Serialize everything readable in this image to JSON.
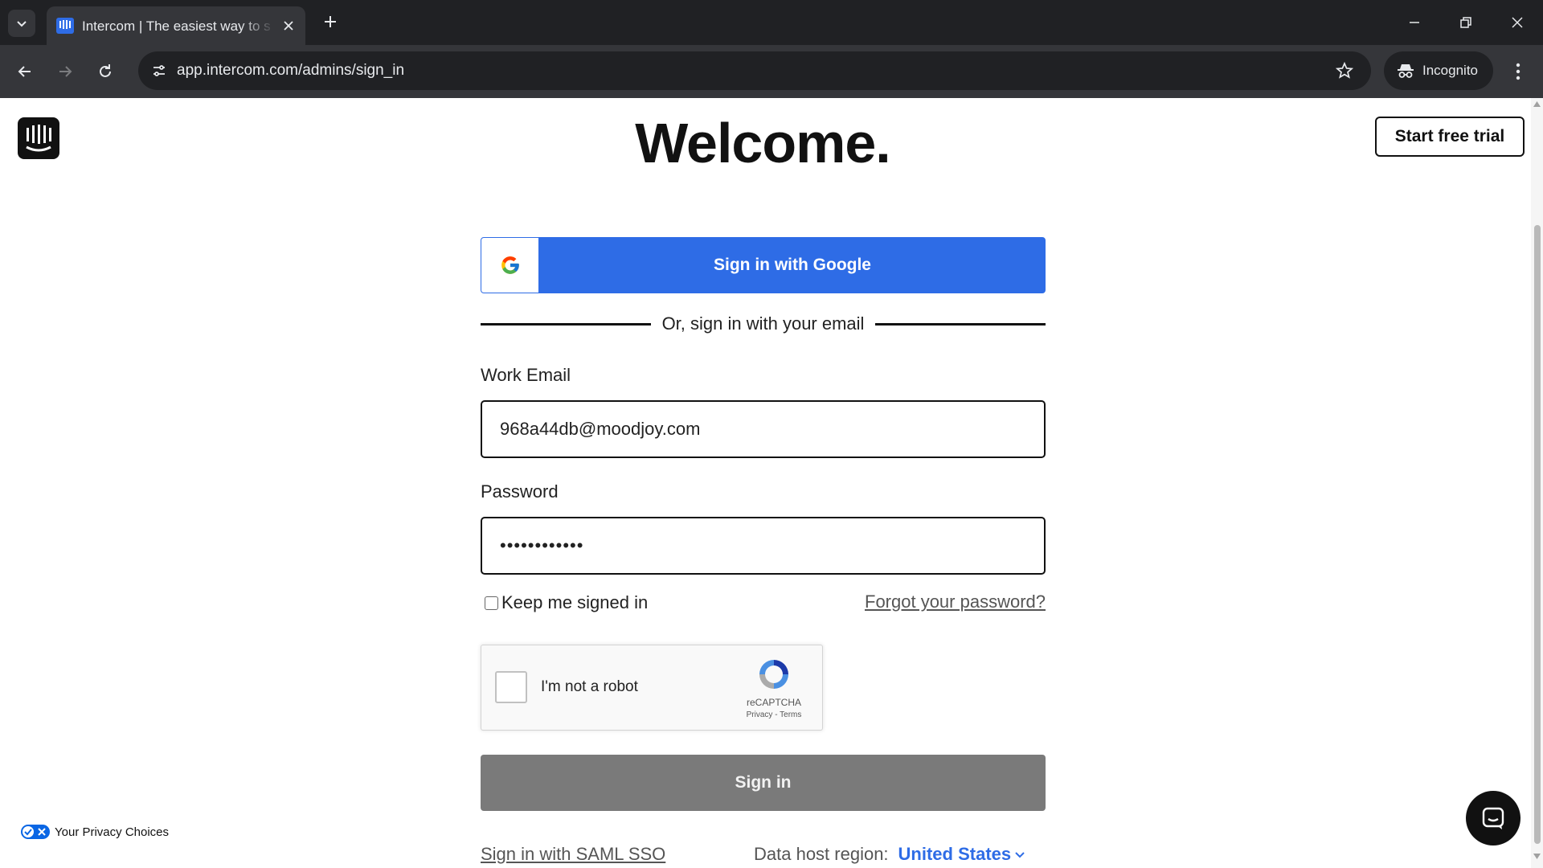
{
  "browser": {
    "tab_title": "Intercom | The easiest way to s",
    "url": "app.intercom.com/admins/sign_in",
    "incognito_label": "Incognito",
    "icons": {
      "tab_list": "chevron-down-icon",
      "close_tab": "close-icon",
      "new_tab": "plus-icon",
      "back": "arrow-left-icon",
      "forward": "arrow-right-icon",
      "reload": "reload-icon",
      "site_info": "tune-icon",
      "bookmark": "star-icon",
      "menu": "more-vert-icon"
    }
  },
  "page": {
    "header": {
      "title": "Welcome.",
      "start_trial_label": "Start free trial"
    },
    "google_button_label": "Sign in with Google",
    "divider_text": "Or, sign in with your email",
    "email": {
      "label": "Work Email",
      "value": "968a44db@moodjoy.com"
    },
    "password": {
      "label": "Password",
      "value": "••••••••••••"
    },
    "keep_signed_in_label": "Keep me signed in",
    "keep_signed_in_checked": false,
    "forgot_password_label": "Forgot your password?",
    "recaptcha": {
      "label": "I'm not a robot",
      "brand": "reCAPTCHA",
      "terms": "Privacy - Terms"
    },
    "sign_in_label": "Sign in",
    "saml_label": "Sign in with SAML SSO",
    "region": {
      "label": "Data host region:",
      "value": "United States"
    },
    "privacy_choices_label": "Your Privacy Choices"
  },
  "colors": {
    "brand_blue": "#2e6ce6",
    "sign_in_disabled": "#7a7a7a",
    "chrome_dark": "#202124",
    "chrome_toolbar": "#35363a"
  }
}
